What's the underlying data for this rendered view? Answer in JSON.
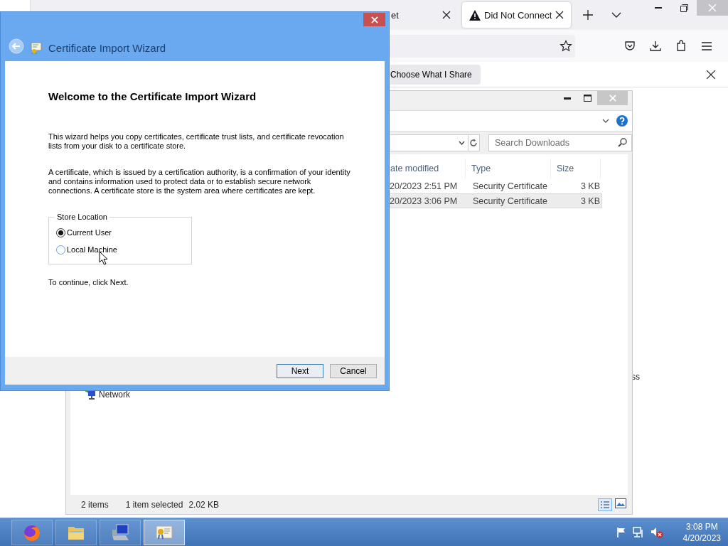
{
  "browser": {
    "tabs": [
      {
        "title": "et",
        "selected": false
      },
      {
        "title": "Did Not Connect",
        "selected": true
      }
    ],
    "notification": {
      "button": "Choose What I Share"
    },
    "page_text": "ss"
  },
  "explorer": {
    "search": {
      "placeholder": "Search Downloads"
    },
    "columns": [
      "ate modified",
      "Type",
      "Size"
    ],
    "rows": [
      {
        "date": "20/2023 2:51 PM",
        "type": "Security Certificate",
        "size": "3 KB",
        "selected": false
      },
      {
        "date": "20/2023 3:06 PM",
        "type": "Security Certificate",
        "size": "3 KB",
        "selected": true
      }
    ],
    "nav_items": [
      "Network"
    ],
    "status": {
      "items": "2 items",
      "selection": "1 item selected",
      "size": "2.02 KB"
    }
  },
  "wizard": {
    "title": "Certificate Import Wizard",
    "heading": "Welcome to the Certificate Import Wizard",
    "paragraphs": [
      "This wizard helps you copy certificates, certificate trust lists, and certificate revocation lists from your disk to a certificate store.",
      "A certificate, which is issued by a certification authority, is a confirmation of your identity and contains information used to protect data or to establish secure network connections. A certificate store is the system area where certificates are kept."
    ],
    "store_location": {
      "label": "Store Location",
      "options": [
        {
          "label": "Current User",
          "selected": true
        },
        {
          "label": "Local Machine",
          "selected": false
        }
      ]
    },
    "hint": "To continue, click Next.",
    "buttons": [
      {
        "label": "Next",
        "default": true
      },
      {
        "label": "Cancel",
        "default": false
      }
    ]
  },
  "taskbar": {
    "apps": [
      {
        "kind": "firefox",
        "active": false
      },
      {
        "kind": "explorer",
        "active": false
      },
      {
        "kind": "computer",
        "active": false
      },
      {
        "kind": "certificate",
        "active": true
      }
    ],
    "clock": {
      "time": "3:08 PM",
      "date": "4/20/2023"
    }
  }
}
